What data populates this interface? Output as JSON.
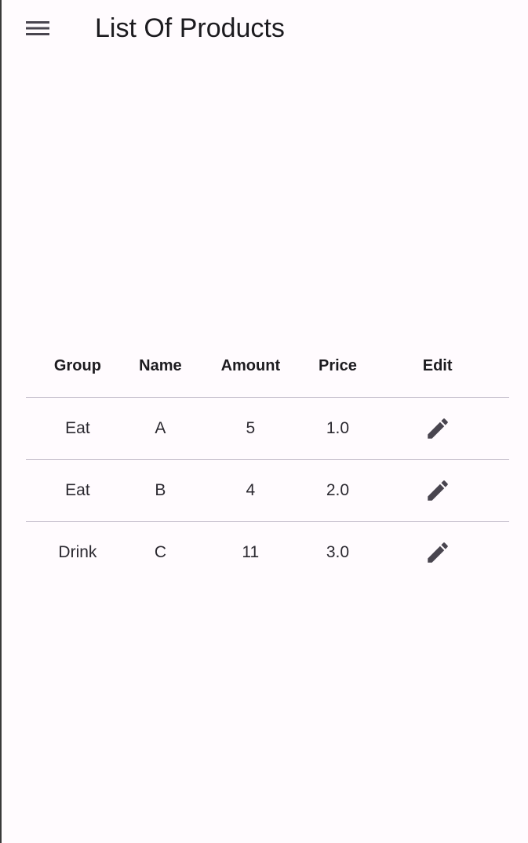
{
  "app_bar": {
    "title": "List Of Products",
    "menu_icon": "menu-icon"
  },
  "table": {
    "columns": [
      "Group",
      "Name",
      "Amount",
      "Price",
      "Edit"
    ],
    "rows": [
      {
        "group": "Eat",
        "name": "A",
        "amount": "5",
        "price": "1.0",
        "edit_icon": "pencil-icon"
      },
      {
        "group": "Eat",
        "name": "B",
        "amount": "4",
        "price": "2.0",
        "edit_icon": "pencil-icon"
      },
      {
        "group": "Drink",
        "name": "C",
        "amount": "11",
        "price": "3.0",
        "edit_icon": "pencil-icon"
      }
    ]
  },
  "colors": {
    "background": "#fffbfe",
    "text": "#1c1b1f",
    "icon": "#49454f",
    "divider": "#cac4d0"
  }
}
